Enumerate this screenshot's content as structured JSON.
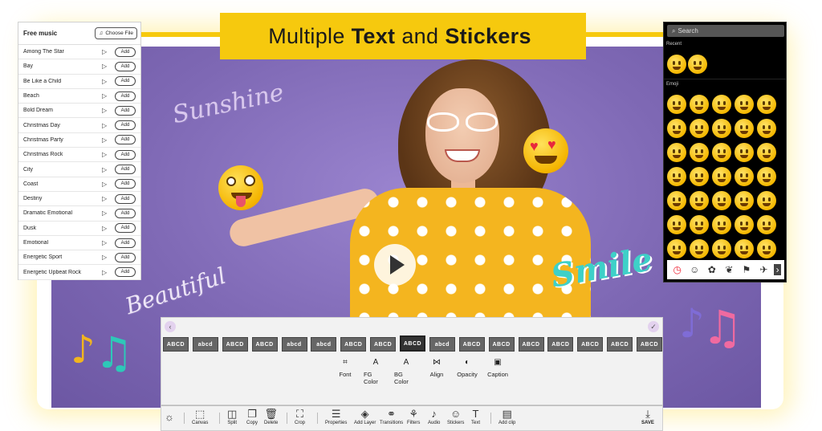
{
  "banner": {
    "pre": "Multiple",
    "bold1": "Text",
    "mid": "and",
    "bold2": "Stickers"
  },
  "music_panel": {
    "title": "Free music",
    "choose_label": "Choose File",
    "add_label": "Add",
    "tracks": [
      "Among The Star",
      "Bay",
      "Be Like a Child",
      "Beach",
      "Bold Dream",
      "Christmas Day",
      "Christmas Party",
      "Christmas Rock",
      "City",
      "Coast",
      "Destiny",
      "Dramatic Emotional",
      "Dusk",
      "Emotional",
      "Energetic Sport",
      "Energetic Upbeat Rock"
    ]
  },
  "emoji_panel": {
    "search_placeholder": "Search",
    "recent_label": "Recent",
    "emoji_label": "Emoji"
  },
  "canvas_text": {
    "sunshine": "Sunshine",
    "beautiful": "Beautiful",
    "smile": "Smile"
  },
  "text_styles": [
    "ABCD",
    "abcd",
    "ABCD",
    "ABCD",
    "abcd",
    "abcd",
    "ABCD",
    "ABCD",
    "ABCD",
    "abcd",
    "ABCD",
    "ABCD",
    "ABCD",
    "ABCD",
    "ABCD",
    "ABCD",
    "ABCD"
  ],
  "text_props": [
    {
      "icon": "font-icon",
      "label": "Font",
      "glyph": "⌗"
    },
    {
      "icon": "fg-color-icon",
      "label": "FG Color",
      "glyph": "A"
    },
    {
      "icon": "bg-color-icon",
      "label": "BG Color",
      "glyph": "A"
    },
    {
      "icon": "align-icon",
      "label": "Align",
      "glyph": "⋈"
    },
    {
      "icon": "opacity-icon",
      "label": "Opacity",
      "glyph": "◐"
    },
    {
      "icon": "caption-icon",
      "label": "Caption",
      "glyph": "▣"
    }
  ],
  "toolbar": {
    "canvas": "Canvas",
    "split": "Split",
    "copy": "Copy",
    "delete": "Delete",
    "crop": "Crop",
    "properties": "Properties",
    "add_layer": "Add Layer",
    "transitions": "Transitions",
    "filters": "Filters",
    "audio": "Audio",
    "stickers": "Stickers",
    "text": "Text",
    "add_clip": "Add clip",
    "save": "SAVE"
  },
  "colors": {
    "accent_yellow": "#f6c90e",
    "purple_bg": "#7e68b4",
    "teal": "#3ed0c8"
  }
}
